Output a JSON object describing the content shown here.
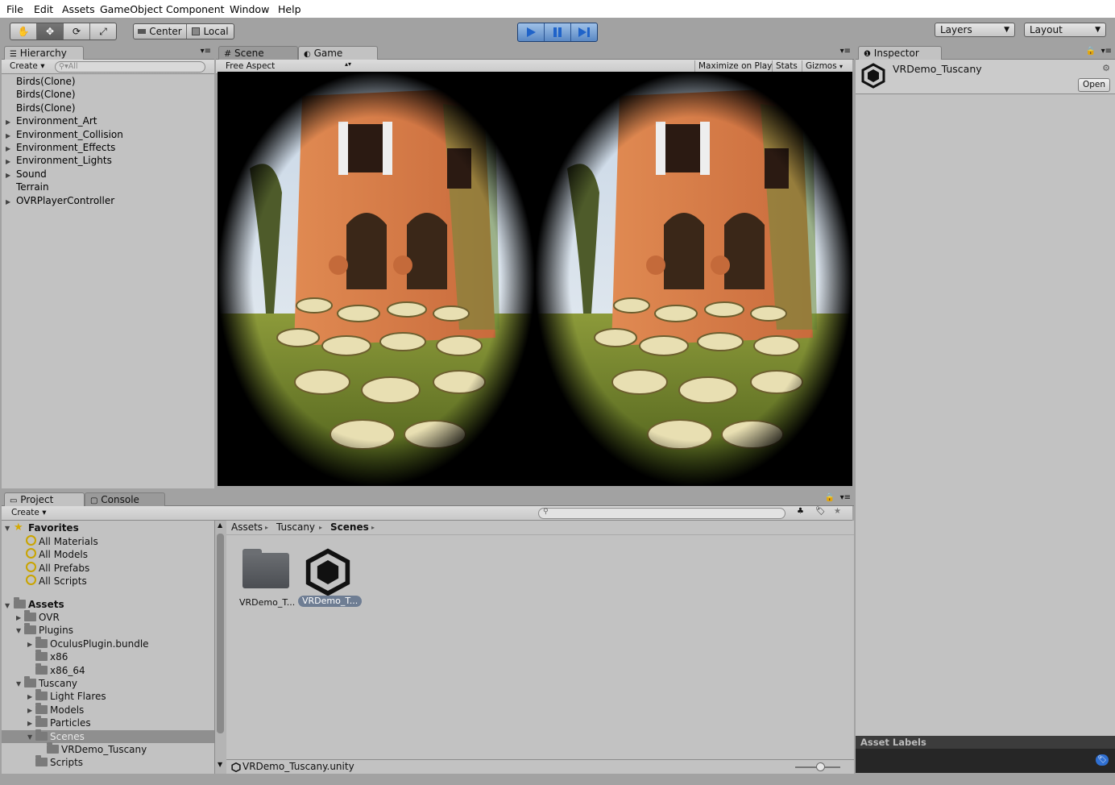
{
  "menu": [
    "File",
    "Edit",
    "Assets",
    "GameObject",
    "Component",
    "Window",
    "Help"
  ],
  "toolbar": {
    "pivot": "Center",
    "space": "Local",
    "layers": "Layers",
    "layout": "Layout"
  },
  "hierarchy": {
    "tab": "Hierarchy",
    "create": "Create",
    "search_placeholder": "All",
    "items": [
      {
        "label": "Birds(Clone)",
        "expandable": false
      },
      {
        "label": "Birds(Clone)",
        "expandable": false
      },
      {
        "label": "Birds(Clone)",
        "expandable": false
      },
      {
        "label": "Environment_Art",
        "expandable": true
      },
      {
        "label": "Environment_Collision",
        "expandable": true
      },
      {
        "label": "Environment_Effects",
        "expandable": true
      },
      {
        "label": "Environment_Lights",
        "expandable": true
      },
      {
        "label": "Sound",
        "expandable": true
      },
      {
        "label": "Terrain",
        "expandable": false
      },
      {
        "label": "OVRPlayerController",
        "expandable": true
      }
    ]
  },
  "views": {
    "scene_tab": "Scene",
    "game_tab": "Game",
    "aspect": "Free Aspect",
    "maximize": "Maximize on Play",
    "stats": "Stats",
    "gizmos": "Gizmos"
  },
  "inspector": {
    "tab": "Inspector",
    "object_name": "VRDemo_Tuscany",
    "open_button": "Open",
    "asset_labels": "Asset Labels"
  },
  "project": {
    "tab": "Project",
    "console_tab": "Console",
    "create": "Create",
    "favorites_label": "Favorites",
    "favorites": [
      "All Materials",
      "All Models",
      "All Prefabs",
      "All Scripts"
    ],
    "assets_label": "Assets",
    "tree": [
      {
        "label": "OVR",
        "indent": 1,
        "arrow": "right"
      },
      {
        "label": "Plugins",
        "indent": 1,
        "arrow": "down"
      },
      {
        "label": "OculusPlugin.bundle",
        "indent": 2,
        "arrow": "right"
      },
      {
        "label": "x86",
        "indent": 2,
        "arrow": ""
      },
      {
        "label": "x86_64",
        "indent": 2,
        "arrow": ""
      },
      {
        "label": "Tuscany",
        "indent": 1,
        "arrow": "down"
      },
      {
        "label": "Light Flares",
        "indent": 2,
        "arrow": "right"
      },
      {
        "label": "Models",
        "indent": 2,
        "arrow": "right"
      },
      {
        "label": "Particles",
        "indent": 2,
        "arrow": "right"
      },
      {
        "label": "Scenes",
        "indent": 2,
        "arrow": "down",
        "selected": true
      },
      {
        "label": "VRDemo_Tuscany",
        "indent": 3,
        "arrow": ""
      },
      {
        "label": "Scripts",
        "indent": 2,
        "arrow": ""
      }
    ],
    "breadcrumb": [
      "Assets",
      "Tuscany",
      "Scenes"
    ],
    "files": [
      {
        "label": "VRDemo_T...",
        "kind": "folder"
      },
      {
        "label": "VRDemo_T...",
        "kind": "unity",
        "selected": true
      }
    ],
    "status_file": "VRDemo_Tuscany.unity"
  }
}
